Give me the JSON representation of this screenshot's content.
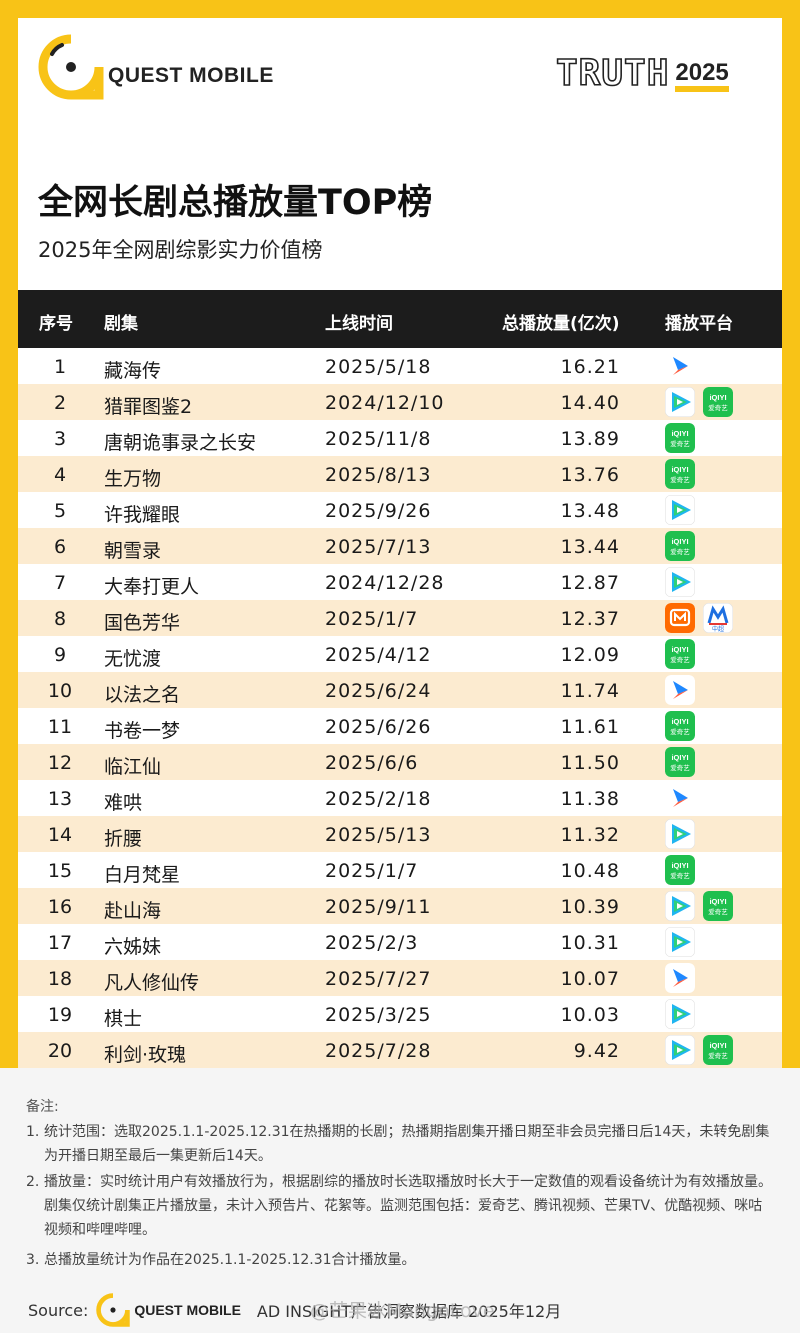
{
  "brand": {
    "logo_text": "QUEST MOBILE",
    "badge_word": "TRUTH",
    "badge_year": "2025"
  },
  "title": "全网长剧总播放量TOP榜",
  "subtitle": "2025年全网剧综影实力价值榜",
  "table": {
    "headers": [
      "序号",
      "剧集",
      "上线时间",
      "总播放量(亿次)",
      "播放平台"
    ],
    "rows": [
      {
        "rank": "1",
        "name": "藏海传",
        "date": "2025/5/18",
        "plays": "16.21",
        "platforms": [
          "youku"
        ]
      },
      {
        "rank": "2",
        "name": "猎罪图鉴2",
        "date": "2024/12/10",
        "plays": "14.40",
        "platforms": [
          "tencent",
          "iqiyi"
        ]
      },
      {
        "rank": "3",
        "name": "唐朝诡事录之长安",
        "date": "2025/11/8",
        "plays": "13.89",
        "platforms": [
          "iqiyi"
        ]
      },
      {
        "rank": "4",
        "name": "生万物",
        "date": "2025/8/13",
        "plays": "13.76",
        "platforms": [
          "iqiyi"
        ]
      },
      {
        "rank": "5",
        "name": "许我耀眼",
        "date": "2025/9/26",
        "plays": "13.48",
        "platforms": [
          "tencent"
        ]
      },
      {
        "rank": "6",
        "name": "朝雪录",
        "date": "2025/7/13",
        "plays": "13.44",
        "platforms": [
          "iqiyi"
        ]
      },
      {
        "rank": "7",
        "name": "大奉打更人",
        "date": "2024/12/28",
        "plays": "12.87",
        "platforms": [
          "tencent"
        ]
      },
      {
        "rank": "8",
        "name": "国色芳华",
        "date": "2025/1/7",
        "plays": "12.37",
        "platforms": [
          "mango",
          "migu"
        ]
      },
      {
        "rank": "9",
        "name": "无忧渡",
        "date": "2025/4/12",
        "plays": "12.09",
        "platforms": [
          "iqiyi"
        ]
      },
      {
        "rank": "10",
        "name": "以法之名",
        "date": "2025/6/24",
        "plays": "11.74",
        "platforms": [
          "youku"
        ]
      },
      {
        "rank": "11",
        "name": "书卷一梦",
        "date": "2025/6/26",
        "plays": "11.61",
        "platforms": [
          "iqiyi"
        ]
      },
      {
        "rank": "12",
        "name": "临江仙",
        "date": "2025/6/6",
        "plays": "11.50",
        "platforms": [
          "iqiyi"
        ]
      },
      {
        "rank": "13",
        "name": "难哄",
        "date": "2025/2/18",
        "plays": "11.38",
        "platforms": [
          "youku"
        ]
      },
      {
        "rank": "14",
        "name": "折腰",
        "date": "2025/5/13",
        "plays": "11.32",
        "platforms": [
          "tencent"
        ]
      },
      {
        "rank": "15",
        "name": "白月梵星",
        "date": "2025/1/7",
        "plays": "10.48",
        "platforms": [
          "iqiyi"
        ]
      },
      {
        "rank": "16",
        "name": "赴山海",
        "date": "2025/9/11",
        "plays": "10.39",
        "platforms": [
          "tencent",
          "iqiyi"
        ]
      },
      {
        "rank": "17",
        "name": "六姊妹",
        "date": "2025/2/3",
        "plays": "10.31",
        "platforms": [
          "tencent"
        ]
      },
      {
        "rank": "18",
        "name": "凡人修仙传",
        "date": "2025/7/27",
        "plays": "10.07",
        "platforms": [
          "youku"
        ]
      },
      {
        "rank": "19",
        "name": "棋士",
        "date": "2025/3/25",
        "plays": "10.03",
        "platforms": [
          "tencent"
        ]
      },
      {
        "rank": "20",
        "name": "利剑·玫瑰",
        "date": "2025/7/28",
        "plays": "9.42",
        "platforms": [
          "tencent",
          "iqiyi"
        ]
      }
    ]
  },
  "platform_icons": {
    "iqiyi_label_top": "iQIYI",
    "iqiyi_label_bottom": "爱奇艺",
    "migu_label": "中超"
  },
  "notes": {
    "heading": "备注:",
    "items": [
      {
        "num": "1.",
        "text": "统计范围：选取2025.1.1-2025.12.31在热播期的长剧；热播期指剧集开播日期至非会员完播日后14天，未转免剧集为开播日期至最后一集更新后14天。"
      },
      {
        "num": "2.",
        "text": "播放量：实时统计用户有效播放行为，根据剧综的播放时长选取播放时长大于一定数值的观看设备统计为有效播放量。剧集仅统计剧集正片播放量，未计入预告片、花絮等。监测范围包括：爱奇艺、腾讯视频、芒果TV、优酷视频、咪咕视频和哔哩哔哩。"
      },
      {
        "num": "3.",
        "text": "总播放量统计为作品在2025.1.1-2025.12.31合计播放量。"
      }
    ]
  },
  "source": {
    "label": "Source:",
    "brand": "QUEST MOBILE",
    "text": "AD INSIGHT广告洞察数据库 2025年12月"
  },
  "watermark": "@芒果冰MangoLove",
  "colors": {
    "accent": "#F8C317",
    "header_bg": "#1C1C1C",
    "row_alt": "#FCEBD0",
    "iqiyi": "#1FBF4E",
    "mango": "#FF6A00",
    "youku_blue": "#1E88FF",
    "youku_orange": "#FF5A3C"
  }
}
